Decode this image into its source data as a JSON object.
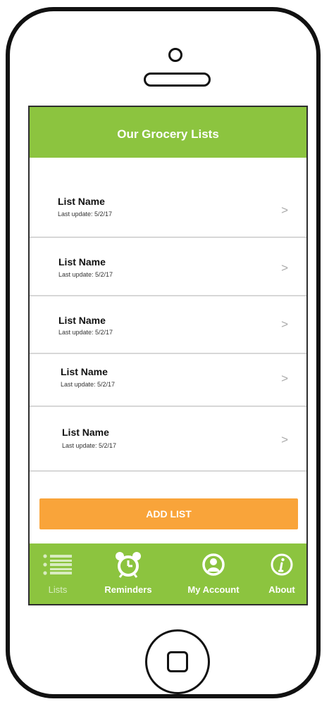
{
  "app": {
    "title": "Our Grocery Lists"
  },
  "lists": [
    {
      "name": "List Name",
      "updated": "Last update: 5/2/17",
      "chevron": ">"
    },
    {
      "name": "List Name",
      "updated": "Last update: 5/2/17",
      "chevron": ">"
    },
    {
      "name": "List Name",
      "updated": "Last update: 5/2/17",
      "chevron": ">"
    },
    {
      "name": "List Name",
      "updated": "Last update: 5/2/17",
      "chevron": ">"
    },
    {
      "name": "List Name",
      "updated": "Last update: 5/2/17",
      "chevron": ">"
    }
  ],
  "actions": {
    "add_list_label": "ADD LIST"
  },
  "tabs": [
    {
      "label": "Lists",
      "icon": "list-icon",
      "active": true
    },
    {
      "label": "Reminders",
      "icon": "alarm-clock-icon",
      "active": false
    },
    {
      "label": "My Account",
      "icon": "user-icon",
      "active": false
    },
    {
      "label": "About",
      "icon": "info-icon",
      "active": false
    }
  ],
  "colors": {
    "brand_green": "#8cc43f",
    "action_orange": "#f9a43a",
    "tab_active_label": "#d8ecc0"
  }
}
